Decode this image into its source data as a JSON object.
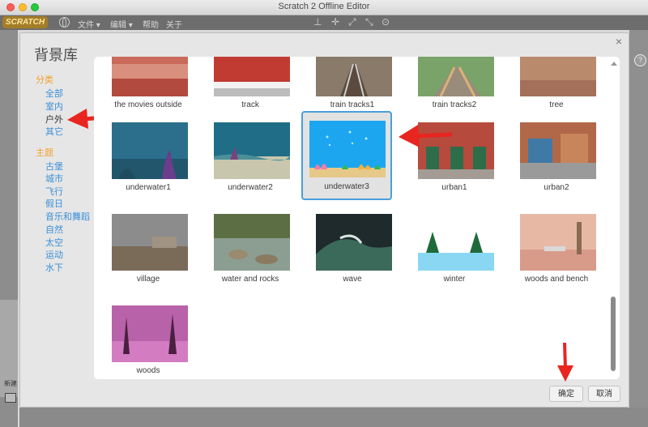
{
  "window": {
    "title": "Scratch 2 Offline Editor"
  },
  "menubar": {
    "logo": "SCRATCH",
    "items": [
      "文件 ▾",
      "编辑 ▾",
      "帮助",
      "关于"
    ]
  },
  "dialog": {
    "title": "背景库",
    "close": "×",
    "category_heading": "分类",
    "categories": [
      {
        "label": "全部"
      },
      {
        "label": "室内"
      },
      {
        "label": "户外",
        "selected": true
      },
      {
        "label": "其它"
      }
    ],
    "theme_heading": "主题",
    "themes": [
      "古堡",
      "城市",
      "飞行",
      "假日",
      "音乐和舞蹈",
      "自然",
      "太空",
      "运动",
      "水下"
    ],
    "backdrops": [
      {
        "label": "the movies outside",
        "row": 0,
        "col": 0
      },
      {
        "label": "track",
        "row": 0,
        "col": 1
      },
      {
        "label": "train tracks1",
        "row": 0,
        "col": 2
      },
      {
        "label": "train tracks2",
        "row": 0,
        "col": 3
      },
      {
        "label": "tree",
        "row": 0,
        "col": 4
      },
      {
        "label": "underwater1",
        "row": 1,
        "col": 0
      },
      {
        "label": "underwater2",
        "row": 1,
        "col": 1
      },
      {
        "label": "underwater3",
        "row": 1,
        "col": 2,
        "selected": true
      },
      {
        "label": "urban1",
        "row": 1,
        "col": 3
      },
      {
        "label": "urban2",
        "row": 1,
        "col": 4
      },
      {
        "label": "village",
        "row": 2,
        "col": 0
      },
      {
        "label": "water and rocks",
        "row": 2,
        "col": 1
      },
      {
        "label": "wave",
        "row": 2,
        "col": 2
      },
      {
        "label": "winter",
        "row": 2,
        "col": 3
      },
      {
        "label": "woods and bench",
        "row": 2,
        "col": 4
      },
      {
        "label": "woods",
        "row": 3,
        "col": 0
      }
    ],
    "ok_label": "确定",
    "cancel_label": "取消"
  },
  "background": {
    "new_label": "新建",
    "help_icon": "?"
  },
  "colors": {
    "accent": "#f2a02b",
    "link": "#3a8fd8",
    "selection": "#4a9fdb",
    "arrow": "#e8251f"
  }
}
